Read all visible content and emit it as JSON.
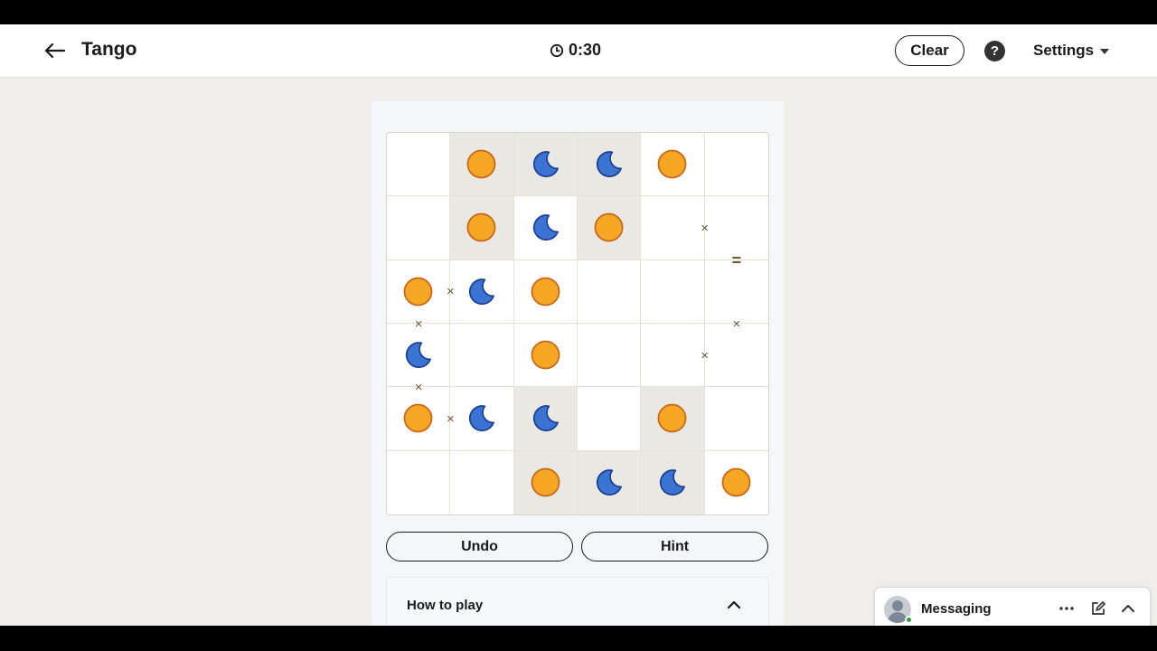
{
  "header": {
    "title": "Tango",
    "timer": "0:30",
    "clear_label": "Clear",
    "help_label": "?",
    "settings_label": "Settings"
  },
  "board": {
    "size": 6,
    "cells": [
      [
        "",
        "sun",
        "moon",
        "moon",
        "sun",
        ""
      ],
      [
        "",
        "sun",
        "moon",
        "sun",
        "",
        ""
      ],
      [
        "sun",
        "moon",
        "sun",
        "",
        "",
        ""
      ],
      [
        "moon",
        "",
        "sun",
        "",
        "",
        ""
      ],
      [
        "sun",
        "moon",
        "moon",
        "",
        "sun",
        ""
      ],
      [
        "",
        "",
        "sun",
        "moon",
        "moon",
        "sun"
      ]
    ],
    "locked": [
      [
        false,
        true,
        true,
        true,
        false,
        false
      ],
      [
        false,
        true,
        false,
        true,
        false,
        false
      ],
      [
        false,
        false,
        false,
        false,
        false,
        false
      ],
      [
        false,
        false,
        false,
        false,
        false,
        false
      ],
      [
        false,
        false,
        true,
        false,
        true,
        false
      ],
      [
        false,
        false,
        true,
        true,
        true,
        false
      ]
    ],
    "constraints": [
      {
        "between": [
          [
            1,
            4
          ],
          [
            1,
            5
          ]
        ],
        "symbol": "×"
      },
      {
        "between": [
          [
            1,
            5
          ],
          [
            2,
            5
          ]
        ],
        "symbol": "="
      },
      {
        "between": [
          [
            2,
            0
          ],
          [
            2,
            1
          ]
        ],
        "symbol": "×"
      },
      {
        "between": [
          [
            2,
            0
          ],
          [
            3,
            0
          ]
        ],
        "symbol": "×"
      },
      {
        "between": [
          [
            2,
            5
          ],
          [
            3,
            5
          ]
        ],
        "symbol": "×"
      },
      {
        "between": [
          [
            3,
            4
          ],
          [
            3,
            5
          ]
        ],
        "symbol": "×"
      },
      {
        "between": [
          [
            3,
            0
          ],
          [
            4,
            0
          ]
        ],
        "symbol": "×"
      },
      {
        "between": [
          [
            4,
            0
          ],
          [
            4,
            1
          ]
        ],
        "symbol": "×"
      }
    ],
    "colors": {
      "sun_fill": "#f5a623",
      "sun_stroke": "#c8661a",
      "moon_fill": "#3b73d4",
      "moon_stroke": "#1d3f8f",
      "locked_bg": "#eae8e2"
    }
  },
  "actions": {
    "undo_label": "Undo",
    "hint_label": "Hint"
  },
  "how_to_play": {
    "label": "How to play"
  },
  "messaging": {
    "label": "Messaging"
  }
}
